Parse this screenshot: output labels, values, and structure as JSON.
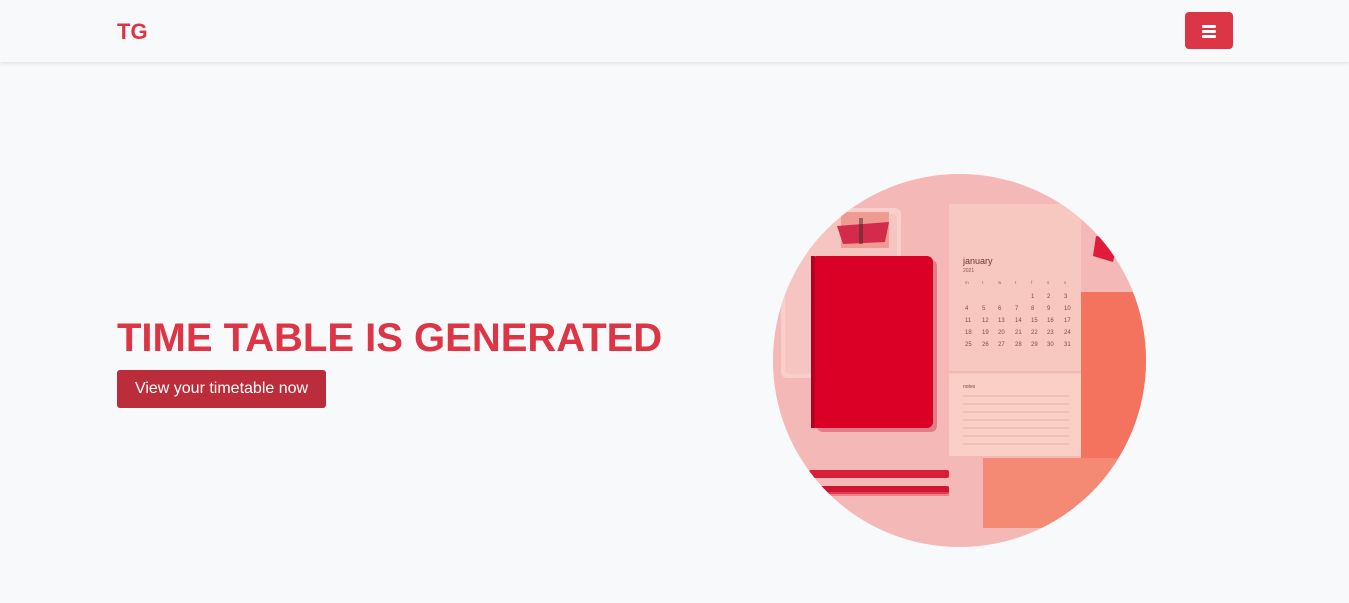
{
  "navbar": {
    "brand": "TG",
    "menu_icon": "hamburger-menu-icon"
  },
  "hero": {
    "title": "TIME TABLE IS GENERATED",
    "cta_label": "View your timetable now",
    "image": {
      "calendar_month": "january",
      "calendar_year": "2021",
      "calendar_weekdays": [
        "m",
        "t",
        "w",
        "t",
        "f",
        "s",
        "s"
      ],
      "calendar_days": [
        [
          "",
          "",
          "",
          "",
          "1",
          "2",
          "3"
        ],
        [
          "4",
          "5",
          "6",
          "7",
          "8",
          "9",
          "10"
        ],
        [
          "11",
          "12",
          "13",
          "14",
          "15",
          "16",
          "17"
        ],
        [
          "18",
          "19",
          "20",
          "21",
          "22",
          "23",
          "24"
        ],
        [
          "25",
          "26",
          "27",
          "28",
          "29",
          "30",
          "31"
        ]
      ],
      "notes_label": "notes"
    }
  },
  "colors": {
    "accent": "#dc3545",
    "accent_dark": "#bb2d3b",
    "background": "#f8f9fa"
  }
}
